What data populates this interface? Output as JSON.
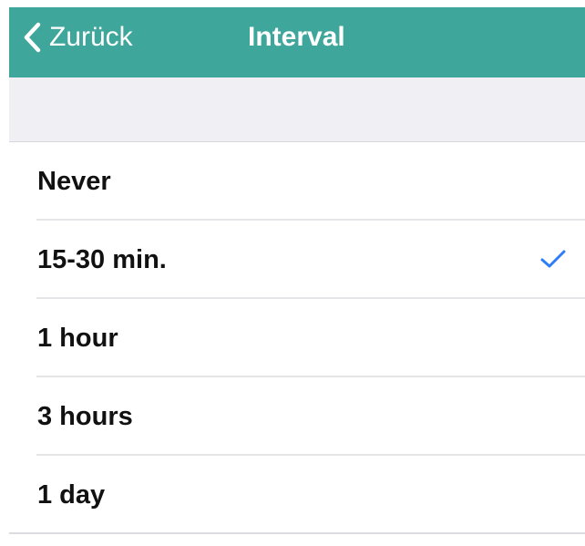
{
  "nav": {
    "back_label": "Zurück",
    "title": "Interval",
    "back_icon": "chevron-left-icon",
    "background_color": "#3fa69b"
  },
  "list": {
    "items": [
      {
        "label": "Never",
        "selected": false
      },
      {
        "label": "15-30 min.",
        "selected": true
      },
      {
        "label": "1 hour",
        "selected": false
      },
      {
        "label": "3 hours",
        "selected": false
      },
      {
        "label": "1 day",
        "selected": false
      }
    ],
    "check_icon": "checkmark-icon",
    "check_color": "#2f7df6"
  }
}
